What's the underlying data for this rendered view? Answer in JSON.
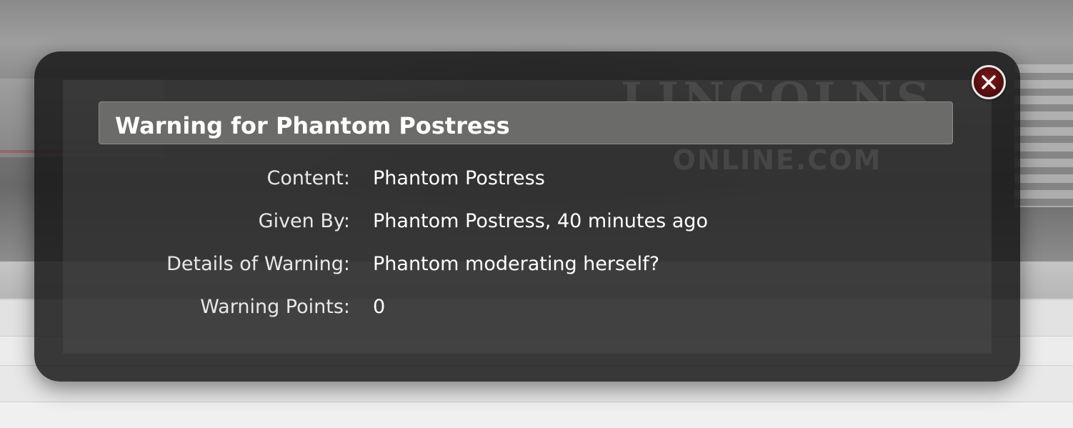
{
  "overlay": {
    "title": "Warning for Phantom Postress",
    "close_icon": "close-icon",
    "watermark": {
      "line1": "LINCOLNS",
      "line2": "ONLINE.COM"
    }
  },
  "details": [
    {
      "label": "Content:",
      "value": "Phantom Postress"
    },
    {
      "label": "Given By:",
      "value": "Phantom Postress, 40 minutes ago"
    },
    {
      "label": "Details of Warning:",
      "value": "Phantom moderating herself?"
    },
    {
      "label": "Warning Points:",
      "value": "0"
    }
  ],
  "colors": {
    "overlay_bg": "#161616",
    "title_bar_bg": "#6b6b69",
    "close_button_bg": "#5a0f0f",
    "text": "#ffffff"
  }
}
